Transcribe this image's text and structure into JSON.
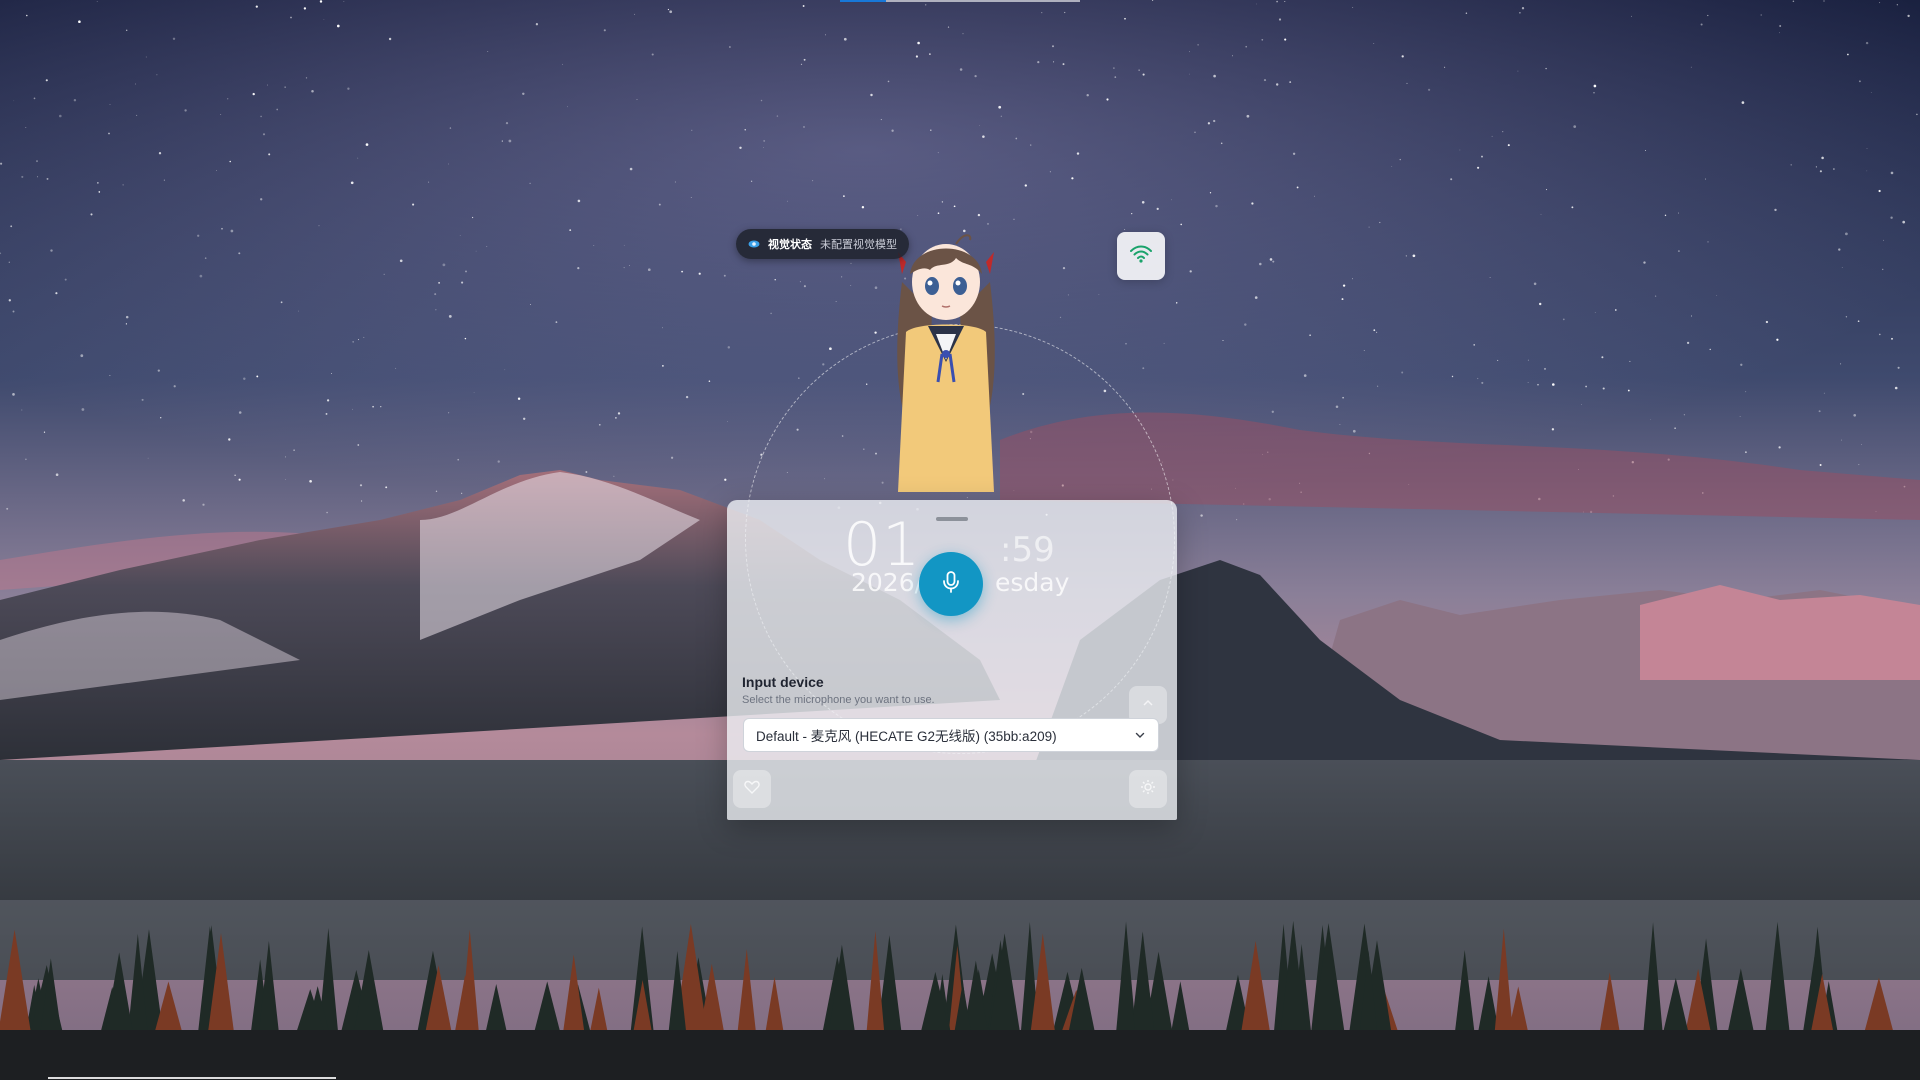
{
  "vision_status": {
    "label": "视觉状态",
    "value": "未配置视觉模型",
    "icon": "eye-icon"
  },
  "network": {
    "icon": "wifi-icon",
    "color": "#1aa36b"
  },
  "clock": {
    "hours": "01",
    "minutes": ":59",
    "year": "2026/",
    "weekday": "esday"
  },
  "voice_panel": {
    "mic_icon": "microphone-icon",
    "accent": "#1296c4",
    "input_device": {
      "title": "Input device",
      "description": "Select the microphone you want to use.",
      "selected": "Default - 麦克风 (HECATE G2无线版) (35bb:a209)"
    }
  }
}
